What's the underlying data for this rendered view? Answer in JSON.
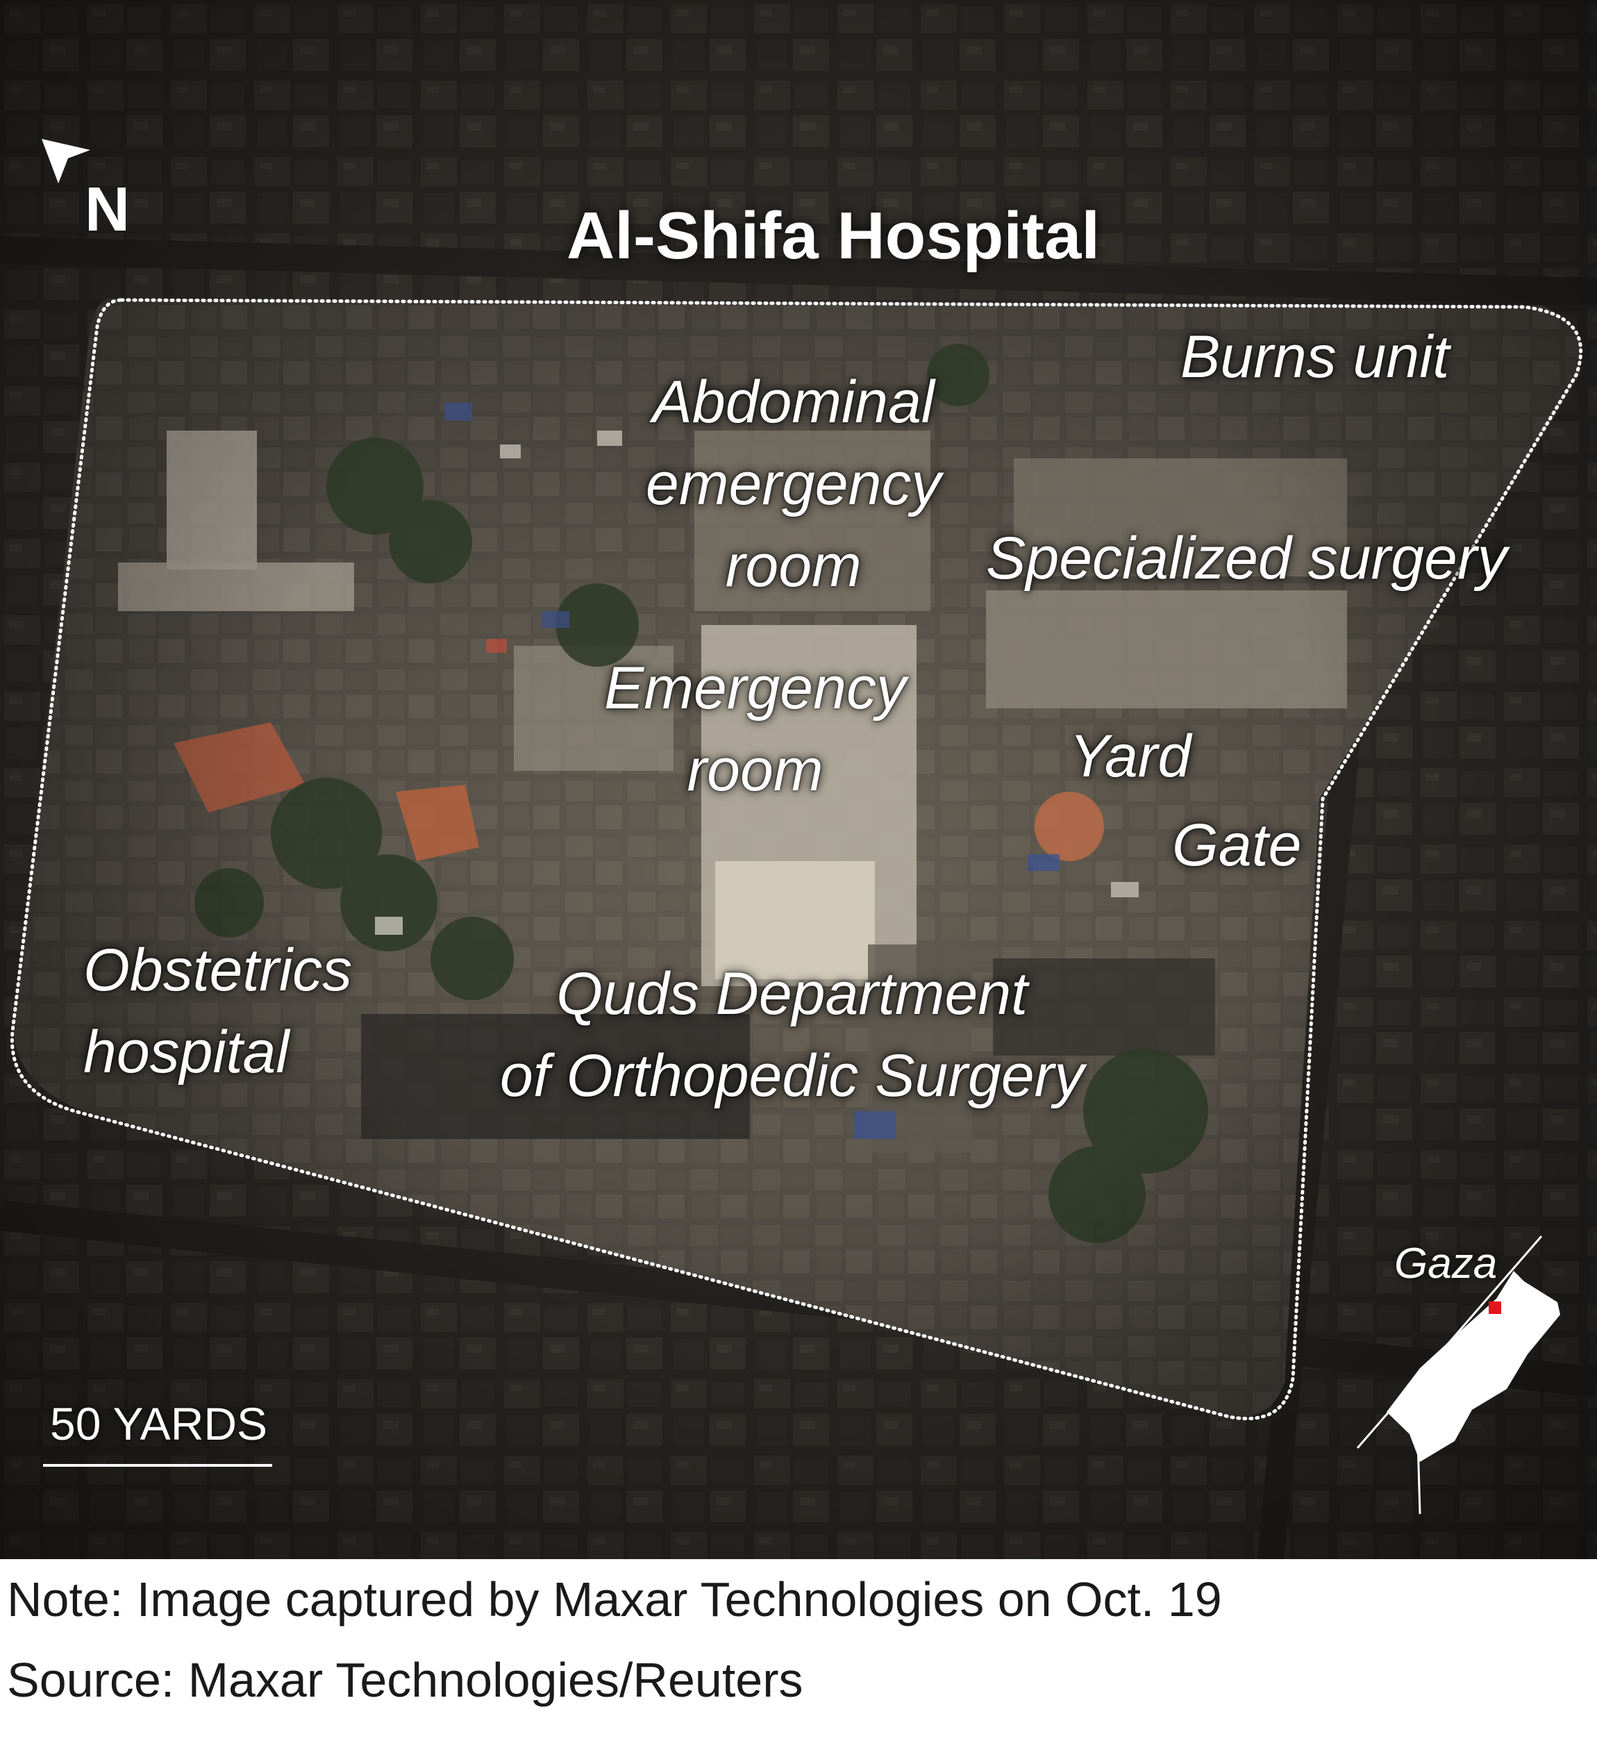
{
  "title": "Al-Shifa Hospital",
  "north_arrow": {
    "letter": "N",
    "icon": "north-arrow-icon"
  },
  "facility_labels": {
    "burns_unit": "Burns unit",
    "abdominal_er": [
      "Abdominal",
      "emergency",
      "room"
    ],
    "specialized_surgery": "Specialized surgery",
    "emergency_room": [
      "Emergency",
      "room"
    ],
    "yard": "Yard",
    "gate": "Gate",
    "obstetrics": [
      "Obstetrics",
      "hospital"
    ],
    "quds": [
      "Quds Department",
      "of Orthopedic Surgery"
    ]
  },
  "scale_bar": {
    "label": "50 YARDS"
  },
  "locator_inset": {
    "label": "Gaza",
    "marker_color": "#e8141b"
  },
  "footer": {
    "note": "Note: Image captured by Maxar Technologies on Oct. 19",
    "source": "Source: Maxar Technologies/Reuters"
  },
  "colors": {
    "label_text": "#ffffff",
    "background": "#ffffff",
    "footer_text": "#1a1a1a"
  }
}
